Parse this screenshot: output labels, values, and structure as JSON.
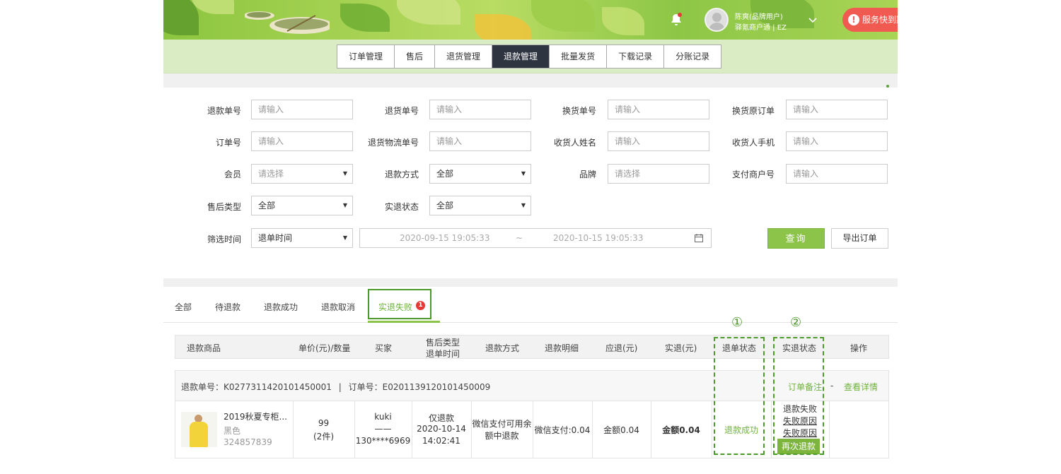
{
  "header": {
    "user_name": "陈爽(品牌用户)",
    "user_sub": "驿氪商户通 | EZ",
    "service_button": "服务快到期"
  },
  "nav_tabs": [
    "订单管理",
    "售后",
    "退货管理",
    "退款管理",
    "批量发货",
    "下载记录",
    "分账记录"
  ],
  "nav_active": "退款管理",
  "filters": {
    "refund_no": {
      "label": "退款单号",
      "placeholder": "请输入"
    },
    "return_no": {
      "label": "退货单号",
      "placeholder": "请输入"
    },
    "exchange_no": {
      "label": "换货单号",
      "placeholder": "请输入"
    },
    "exchange_orig_order": {
      "label": "换货原订单",
      "placeholder": "请输入"
    },
    "order_no": {
      "label": "订单号",
      "placeholder": "请输入"
    },
    "return_logistics_no": {
      "label": "退货物流单号",
      "placeholder": "请输入"
    },
    "receiver_name": {
      "label": "收货人姓名",
      "placeholder": "请输入"
    },
    "receiver_phone": {
      "label": "收货人手机",
      "placeholder": "请输入"
    },
    "member": {
      "label": "会员",
      "placeholder": "请选择"
    },
    "refund_method": {
      "label": "退款方式",
      "value": "全部"
    },
    "brand": {
      "label": "品牌",
      "placeholder": "请选择"
    },
    "payment_merchant_no": {
      "label": "支付商户号",
      "placeholder": "请输入"
    },
    "aftersale_type": {
      "label": "售后类型",
      "value": "全部"
    },
    "actual_refund_status": {
      "label": "实退状态",
      "value": "全部"
    },
    "filter_time": {
      "label": "筛选时间",
      "value": "退单时间"
    },
    "date_start": "2020-09-15 19:05:33",
    "date_sep": "~",
    "date_end": "2020-10-15 19:05:33",
    "query_button": "查询",
    "export_button": "导出订单"
  },
  "status_tabs": [
    "全部",
    "待退款",
    "退款成功",
    "退款取消",
    "实退失败"
  ],
  "status_tab_active": "实退失败",
  "status_tab_badge": "1",
  "annotations": [
    "①",
    "②"
  ],
  "table": {
    "headers": [
      "退款商品",
      "单价(元)/数量",
      "买家",
      "售后类型",
      "退单时间",
      "退款方式",
      "退款明细",
      "应退(元)",
      "实退(元)",
      "退单状态",
      "实退状态",
      "操作"
    ],
    "order": {
      "refund_no_label": "退款单号：",
      "refund_no": "K027731142010145000​1",
      "sep": "|",
      "order_no_label": "订单号：",
      "order_no": "E0201139120101450009",
      "remark_link": "订单备注",
      "dash": "-",
      "detail_link": "查看详情"
    },
    "row": {
      "product_name": "2019秋夏专柜...",
      "product_color": "黑色",
      "product_code": "324857839",
      "price": "99",
      "qty": "(2件)",
      "buyer_name": "kuki",
      "buyer_sep": "——",
      "buyer_phone": "130****6969",
      "aftersale_type": "仅退款",
      "refund_date": "2020-10-14",
      "refund_time": "14:02:41",
      "refund_method_l1": "微信支付可用余",
      "refund_method_l2": "额中退款",
      "refund_detail": "微信支付:0.04",
      "should_refund": "金额0.04",
      "actual_refund_label": "金额",
      "actual_refund_value": "0.04",
      "refund_status": "退款成功",
      "actual_status": "退款失败",
      "fail_reason_1": "失败原因",
      "fail_reason_2": "失败原因",
      "retry_button": "再次退款"
    }
  },
  "colors": {
    "brand_green": "#8cc449",
    "annotation_green": "#4c9a2a",
    "nav_active_bg": "#2e3440"
  }
}
